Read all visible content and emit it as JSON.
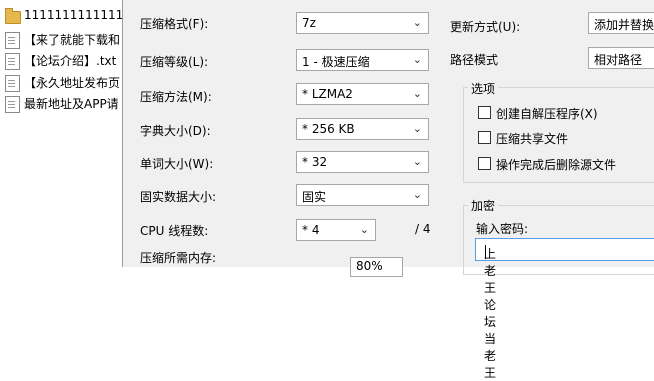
{
  "file_list": [
    {
      "type": "folder",
      "name": "11111111111111"
    },
    {
      "type": "doc",
      "name": "【来了就能下载和"
    },
    {
      "type": "doc",
      "name": "【论坛介绍】.txt"
    },
    {
      "type": "doc",
      "name": "【永久地址发布页"
    },
    {
      "type": "doc",
      "name": "最新地址及APP请"
    }
  ],
  "left_fields": [
    {
      "label": "压缩格式(F):",
      "value": "7z"
    },
    {
      "label": "压缩等级(L):",
      "value": "1 - 极速压缩"
    },
    {
      "label": "压缩方法(M):",
      "value": "* LZMA2"
    },
    {
      "label": "字典大小(D):",
      "value": "* 256 KB"
    },
    {
      "label": "单词大小(W):",
      "value": "* 32"
    },
    {
      "label": "固实数据大小:",
      "value": "固实"
    },
    {
      "label": "CPU 线程数:",
      "value": "* 4"
    }
  ],
  "cpu_total": "/ 4",
  "memory_label": "压缩所需内存:",
  "memory_value": "80%",
  "right": {
    "update_label": "更新方式(U):",
    "update_value": "添加并替换",
    "path_label": "路径模式",
    "path_value": "相对路径",
    "options_title": "选项",
    "options": [
      {
        "label": "创建自解压程序(X)",
        "checked": false
      },
      {
        "label": "压缩共享文件",
        "checked": false
      },
      {
        "label": "操作完成后删除源文件",
        "checked": false
      }
    ],
    "encrypt_title": "加密",
    "password_label": "输入密码:",
    "password_value": "上老王论坛当老王"
  },
  "colors": {
    "dialog_bg": "#f0f0f0",
    "input_focus_border": "#569de5",
    "folder": "#e5b84b"
  }
}
